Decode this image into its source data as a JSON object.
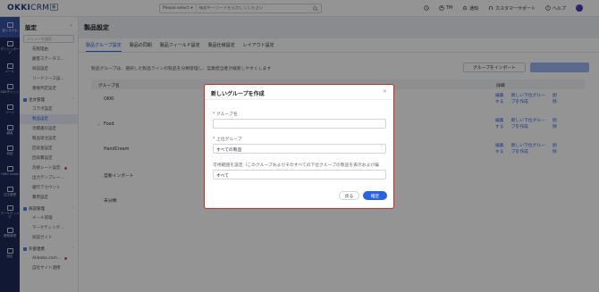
{
  "topbar": {
    "logo_main": "OKKI",
    "logo_suffix": "CRM",
    "logo_badge": "新",
    "search_select": "Please select",
    "search_placeholder": "検索キーワードを入力してください",
    "user": "TM",
    "notice": "通知",
    "support": "カスタマーサポート",
    "help": "ヘルプ"
  },
  "rail": {
    "items": [
      "全システム",
      "ダッシュボード",
      "メール",
      "SNSチャット",
      "リード",
      "顧客",
      "商談",
      "OKKI Leads",
      "注文管理",
      "マーケティング",
      "業務管理",
      "設定"
    ]
  },
  "sidebar": {
    "title": "設定",
    "search_placeholder": "メニューを検索",
    "items_top": [
      "先税理由",
      "顧客ステータス...",
      "商談設定",
      "リードソース設...",
      "重複判定設定"
    ],
    "group_order": "注文管理",
    "items_order": [
      "コラボ設定",
      "製品設定",
      "見積書の設定",
      "製品受注設定",
      "回収金設定",
      "回収費設定",
      "為替レート設定",
      "出力テンプレー...",
      "銀行アカウント",
      "費用設定"
    ],
    "group_biz": "商談管理",
    "items_biz": [
      "メール管理",
      "マーケティング...",
      "商談ガイド"
    ],
    "group_ext": "外部連携",
    "items_ext": [
      "Alibaba.com...",
      "自社サイト連携"
    ]
  },
  "main": {
    "page_title": "製品設定",
    "tabs": [
      "製品グループ設定",
      "製品の同期",
      "製品フィールド設定",
      "製品仕様設定",
      "レイアウト設定"
    ],
    "description": "製品グループは、選択した製品ラインの製品を分類管理し、営業担当者が検索しやすくします",
    "import_button": "グループをインポート",
    "primary_button": "",
    "table_head": {
      "name": "グループ名",
      "detail": "詳細"
    },
    "rows": [
      {
        "name": "OKKI",
        "has_children": false
      },
      {
        "name": "Food",
        "has_children": true
      },
      {
        "name": "HandCream",
        "has_children": false
      },
      {
        "name": "自動インポート",
        "has_children": false
      },
      {
        "name": "未分類",
        "has_children": false
      }
    ],
    "row_actions": {
      "edit": "編集\nする",
      "add_sub": "新しい下位グルー\nプを作成",
      "delete": "削\n除"
    }
  },
  "modal": {
    "title": "新しいグループを作成",
    "close": "×",
    "group_name_label": "グループ名",
    "group_name_value": "",
    "parent_label": "上位グループ",
    "parent_value": "すべての製品",
    "visible_label": "可視範囲を設定（このグループおよびそのすべての下位グループの製品を表示および編",
    "visible_value": "すべて",
    "back_button": "戻る",
    "ok_button": "確定"
  },
  "colors": {
    "accent": "#2563eb",
    "rail": "#1e2a5a",
    "danger": "#dc2626"
  }
}
